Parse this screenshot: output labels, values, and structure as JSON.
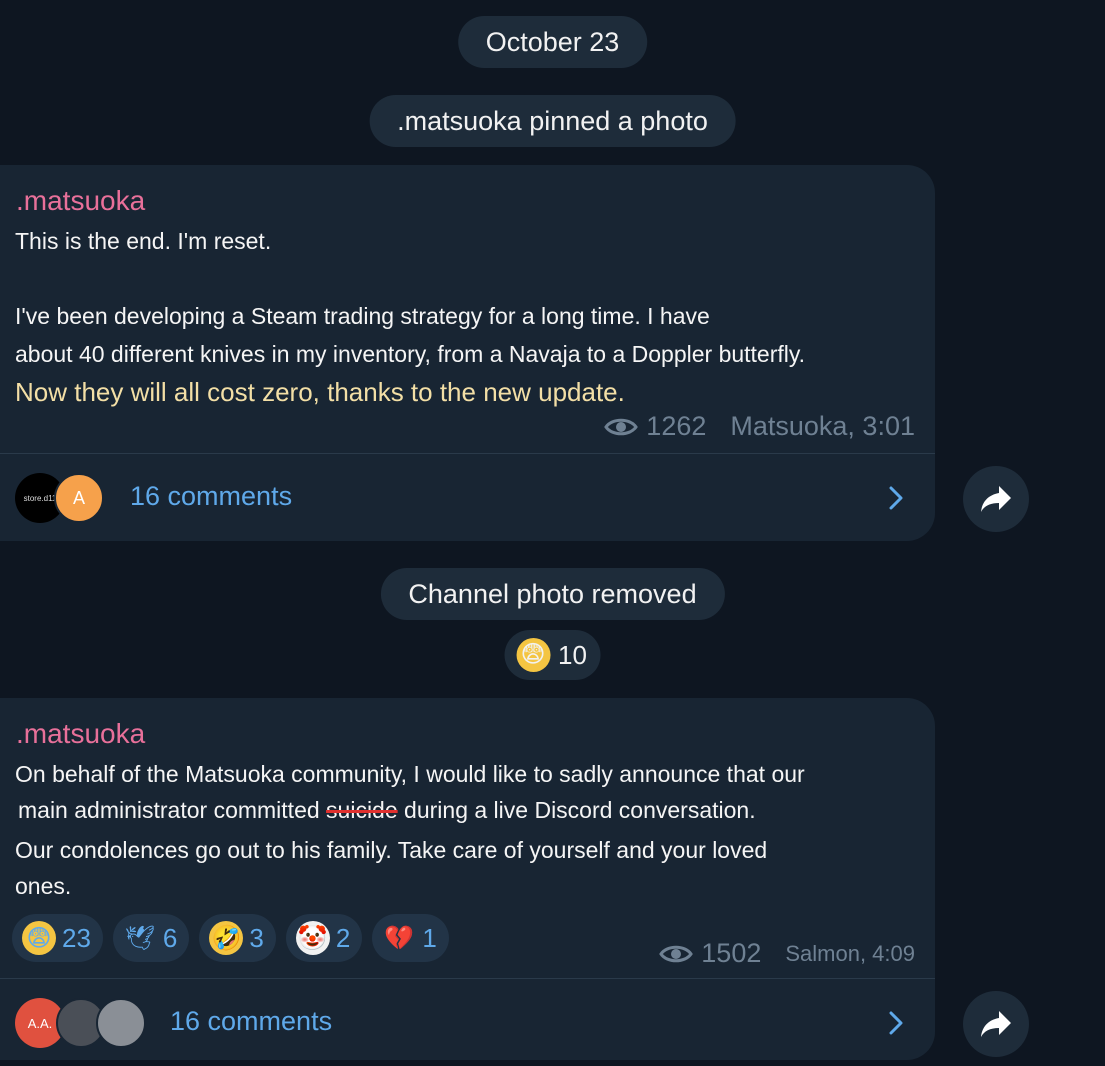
{
  "date_pill": "October 23",
  "pin_notice": ".matsuoka pinned a photo",
  "post1": {
    "author": ".matsuoka",
    "line1": "This is the end. I'm reset.",
    "line2": "I've been developing a Steam trading strategy for a long time. I have",
    "line3": "about 40 different knives in my inventory, from a Navaja to a Doppler butterfly.",
    "line4": "Now they will all cost zero, thanks to the new update.",
    "views": "1262",
    "signature": "Matsuoka, 3:01",
    "avatar1_text": "store.d11",
    "avatar2_text": "A",
    "comments": "16 comments"
  },
  "removed_notice": "Channel photo removed",
  "removed_reaction": {
    "emoji": "😨",
    "count": "10"
  },
  "post2": {
    "author": ".matsuoka",
    "line1": "On behalf of the Matsuoka community, I would like to sadly announce that our",
    "line2_pre": "main administrator committed ",
    "line2_strike": "suicide",
    "line2_post": " during a live Discord conversation.",
    "line3": "Our condolences go out to his family. Take care of yourself and your loved",
    "line4": "ones.",
    "reactions": [
      {
        "emoji": "😨",
        "count": "23"
      },
      {
        "emoji": "🕊",
        "count": "6"
      },
      {
        "emoji": "🤣",
        "count": "3"
      },
      {
        "emoji": "🤡",
        "count": "2"
      },
      {
        "emoji": "💔",
        "count": "1"
      }
    ],
    "views": "1502",
    "signature": "Salmon, 4:09",
    "avatar1_text": "A.A.",
    "comments": "16 comments"
  },
  "colors": {
    "background": "#0e1621",
    "bubble": "#182533",
    "author": "#e8709a",
    "link": "#5fa9ea",
    "meta": "#6f8193"
  }
}
